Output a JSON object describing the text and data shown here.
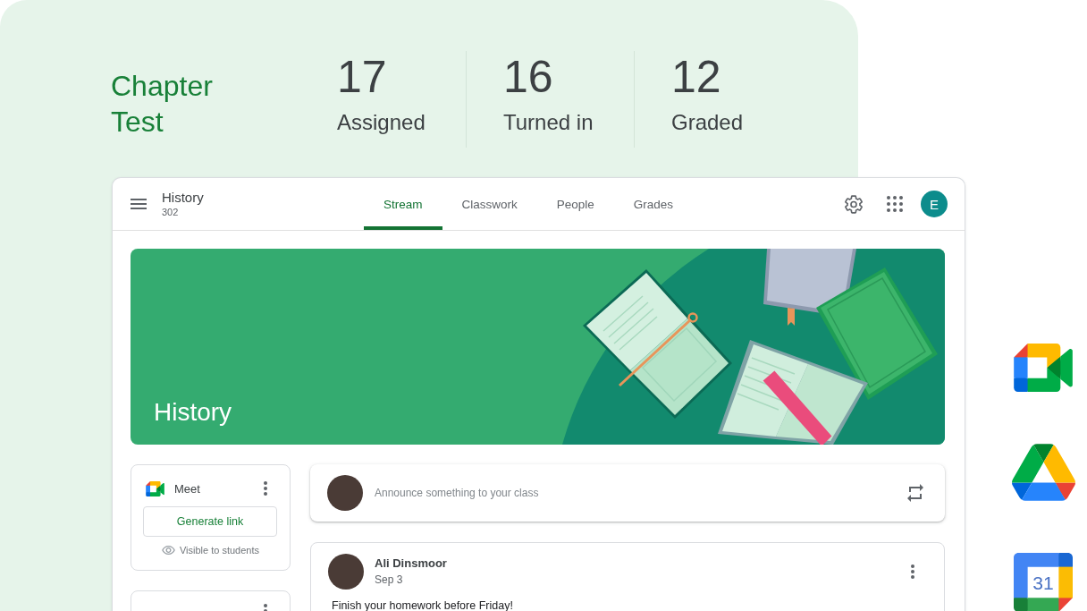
{
  "summary": {
    "title": "Chapter Test",
    "stats": [
      {
        "value": "17",
        "label": "Assigned"
      },
      {
        "value": "16",
        "label": "Turned in"
      },
      {
        "value": "12",
        "label": "Graded"
      }
    ]
  },
  "classroom": {
    "header": {
      "class_name": "History",
      "section": "302",
      "tabs": [
        {
          "label": "Stream",
          "selected": true
        },
        {
          "label": "Classwork",
          "selected": false
        },
        {
          "label": "People",
          "selected": false
        },
        {
          "label": "Grades",
          "selected": false
        }
      ],
      "account_initial": "E"
    },
    "banner": {
      "title": "History"
    },
    "meet_card": {
      "title": "Meet",
      "button": "Generate link",
      "visibility": "Visible to students"
    },
    "announce": {
      "prompt": "Announce something to your class"
    },
    "posts": [
      {
        "author": "Ali Dinsmoor",
        "date": "Sep 3",
        "text": "Finish your homework before Friday!"
      }
    ]
  },
  "dock": [
    {
      "kind": "video"
    },
    {
      "kind": "drive"
    },
    {
      "kind": "calendar",
      "label": "31"
    }
  ]
}
